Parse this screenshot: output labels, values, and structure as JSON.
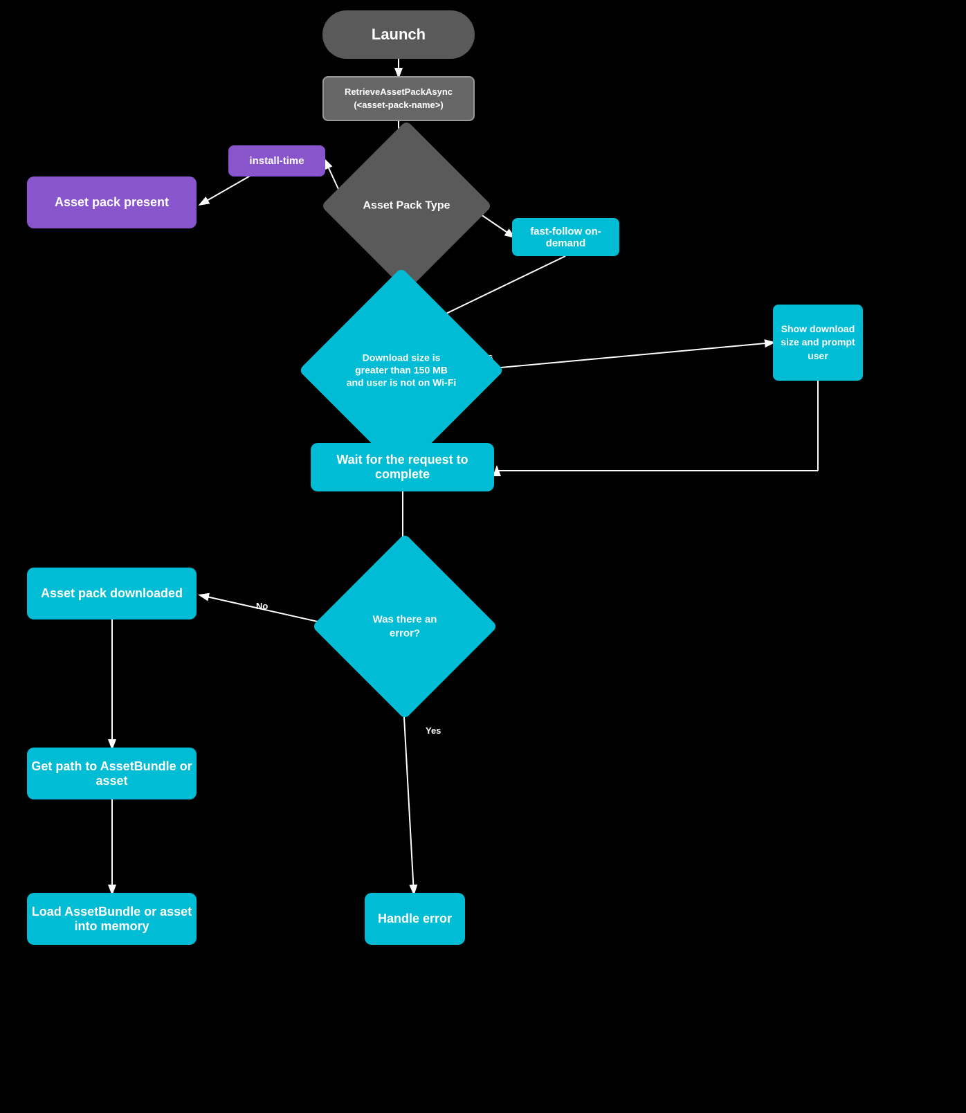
{
  "nodes": {
    "launch": {
      "label": "Launch"
    },
    "retrieve": {
      "label": "RetrieveAssetPackAsync\n(<asset-pack-name>)"
    },
    "install_time": {
      "label": "install-time"
    },
    "asset_pack_present": {
      "label": "Asset pack present"
    },
    "fast_follow": {
      "label": "fast-follow\non-demand"
    },
    "show_download": {
      "label": "Show download size and prompt user"
    },
    "wait": {
      "label": "Wait for the request to complete"
    },
    "asset_downloaded": {
      "label": "Asset pack downloaded"
    },
    "get_path": {
      "label": "Get path to AssetBundle or asset"
    },
    "load_asset": {
      "label": "Load AssetBundle or asset into memory"
    },
    "handle_error": {
      "label": "Handle error"
    },
    "asset_pack_type": {
      "label": "Asset Pack Type"
    },
    "download_size": {
      "label": "Download size is greater than 150 MB and user is not on Wi-Fi"
    },
    "was_error": {
      "label": "Was there an error?"
    }
  }
}
